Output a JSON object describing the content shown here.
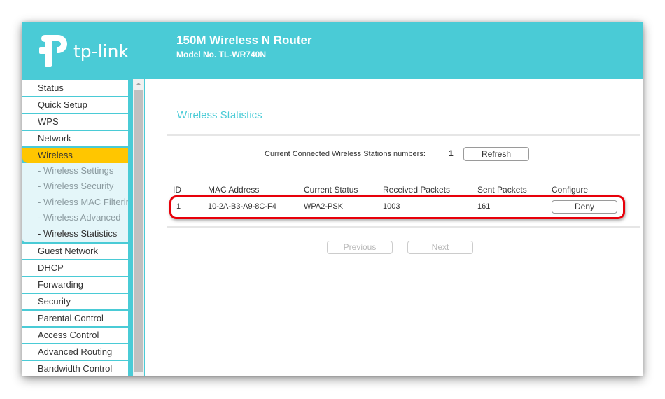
{
  "header": {
    "brand": "tp-link",
    "title": "150M Wireless N Router",
    "model": "Model No. TL-WR740N"
  },
  "colors": {
    "brand_teal": "#4acbd6",
    "active_menu": "#ffc600",
    "highlight_red": "#e8000a"
  },
  "sidebar": {
    "items_before": [
      "Status",
      "Quick Setup",
      "WPS",
      "Network"
    ],
    "active": "Wireless",
    "submenu": [
      "- Wireless Settings",
      "- Wireless Security",
      "- Wireless MAC Filtering",
      "- Wireless Advanced",
      "- Wireless Statistics"
    ],
    "current_submenu": "- Wireless Statistics",
    "items_after": [
      "Guest Network",
      "DHCP",
      "Forwarding",
      "Security",
      "Parental Control",
      "Access Control",
      "Advanced Routing",
      "Bandwidth Control"
    ]
  },
  "main": {
    "page_title": "Wireless Statistics",
    "stations_label": "Current Connected Wireless Stations numbers:",
    "stations_count": "1",
    "refresh_label": "Refresh",
    "table": {
      "columns": [
        "ID",
        "MAC Address",
        "Current Status",
        "Received Packets",
        "Sent Packets",
        "Configure"
      ],
      "rows": [
        {
          "id": "1",
          "mac": "10-2A-B3-A9-8C-F4",
          "status": "WPA2-PSK",
          "received": "1003",
          "sent": "161",
          "action": "Deny"
        }
      ]
    },
    "previous_label": "Previous",
    "next_label": "Next"
  }
}
